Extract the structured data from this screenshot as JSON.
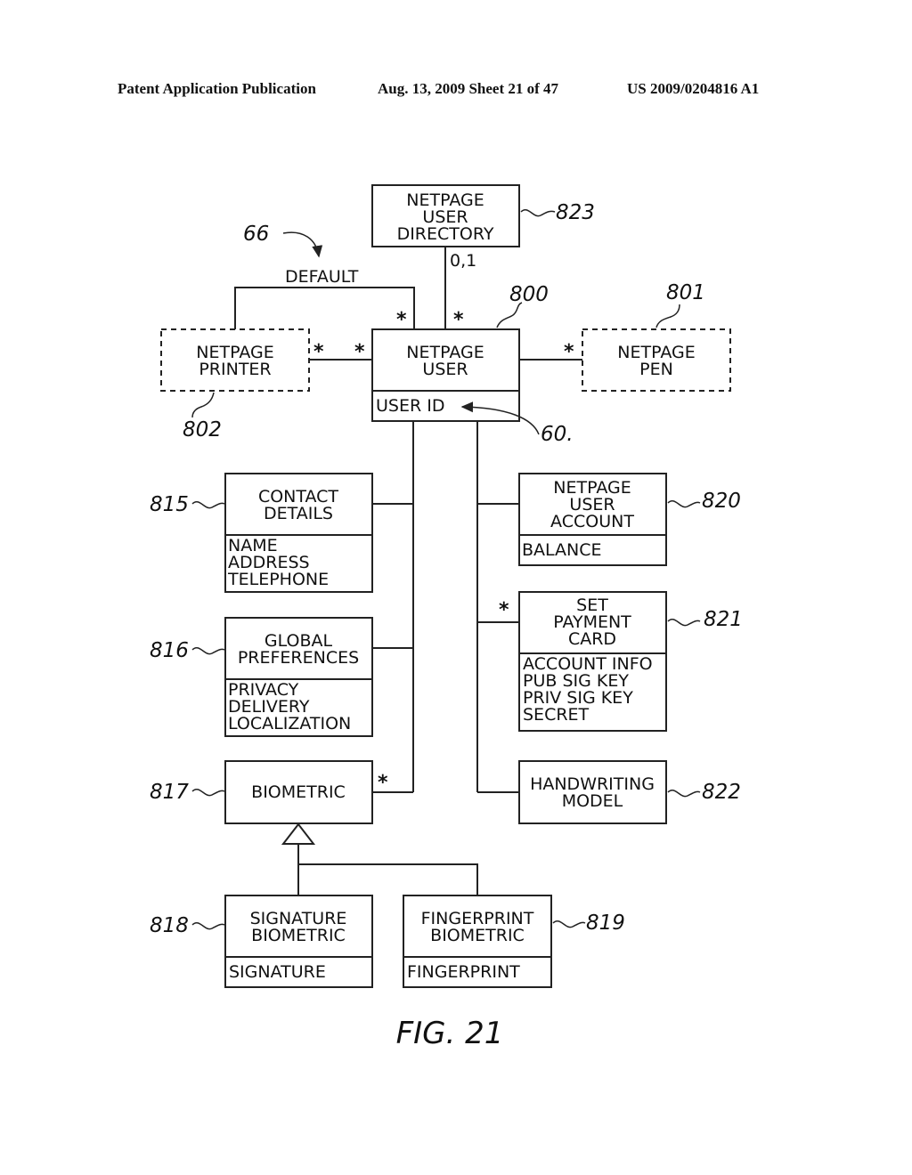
{
  "header": {
    "publication": "Patent Application Publication",
    "date_sheet": "Aug. 13, 2009  Sheet 21 of 47",
    "patent_number": "US 2009/0204816 A1"
  },
  "figure_label": "FIG. 21",
  "classes": {
    "user_directory": {
      "title": [
        "NETPAGE",
        "USER",
        "DIRECTORY"
      ],
      "ref": "823",
      "attributes": []
    },
    "printer": {
      "title": [
        "NETPAGE",
        "PRINTER"
      ],
      "ref": "802",
      "attributes": []
    },
    "user": {
      "title": [
        "NETPAGE",
        "USER"
      ],
      "ref": "800",
      "attributes": [
        "USER ID"
      ]
    },
    "pen": {
      "title": [
        "NETPAGE",
        "PEN"
      ],
      "ref": "801",
      "attributes": []
    },
    "contact_details": {
      "title": [
        "CONTACT",
        "DETAILS"
      ],
      "ref": "815",
      "attributes": [
        "NAME",
        "ADDRESS",
        "TELEPHONE"
      ]
    },
    "global_preferences": {
      "title": [
        "GLOBAL",
        "PREFERENCES"
      ],
      "ref": "816",
      "attributes": [
        "PRIVACY",
        "DELIVERY",
        "LOCALIZATION"
      ]
    },
    "biometric": {
      "title": [
        "BIOMETRIC"
      ],
      "ref": "817",
      "attributes": []
    },
    "signature_biometric": {
      "title": [
        "SIGNATURE",
        "BIOMETRIC"
      ],
      "ref": "818",
      "attributes": [
        "SIGNATURE"
      ]
    },
    "fingerprint_biometric": {
      "title": [
        "FINGERPRINT",
        "BIOMETRIC"
      ],
      "ref": "819",
      "attributes": [
        "FINGERPRINT"
      ]
    },
    "user_account": {
      "title": [
        "NETPAGE",
        "USER",
        "ACCOUNT"
      ],
      "ref": "820",
      "attributes": [
        "BALANCE"
      ]
    },
    "payment_card": {
      "title": [
        "SET",
        "PAYMENT",
        "CARD"
      ],
      "ref": "821",
      "attributes": [
        "ACCOUNT INFO",
        "PUB SIG KEY",
        "PRIV SIG KEY",
        "SECRET"
      ]
    },
    "handwriting_model": {
      "title": [
        "HANDWRITING",
        "MODEL"
      ],
      "ref": "822",
      "attributes": []
    }
  },
  "annotations": {
    "default_label": "DEFAULT",
    "default_ref": "66",
    "user_id_ref": "60.",
    "multiplicity_directory": "0,1",
    "many": "*"
  }
}
